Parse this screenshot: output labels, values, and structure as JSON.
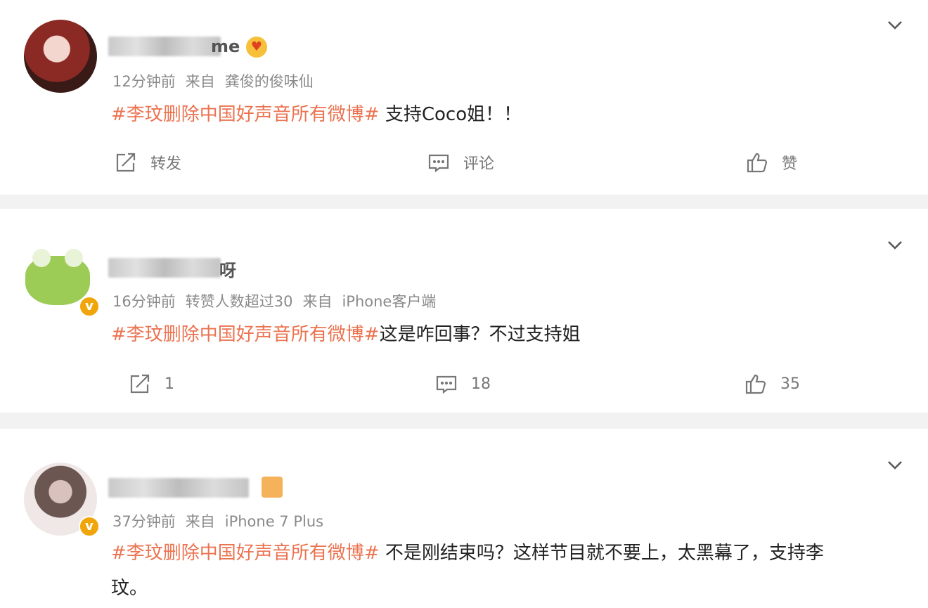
{
  "posts": [
    {
      "username_visible": "me",
      "time": "12分钟前",
      "source_prefix": "来自",
      "source": "龚俊的俊味仙",
      "hot_count": "",
      "topic": "#李玟删除中国好声音所有微博#",
      "text": " 支持Coco姐！！",
      "repost": "转发",
      "comment": "评论",
      "like": "赞"
    },
    {
      "username_visible": "呀",
      "time": "16分钟前",
      "hot_count": "转赞人数超过30",
      "source_prefix": "来自",
      "source": "iPhone客户端",
      "topic": "#李玟删除中国好声音所有微博#",
      "text": "这是咋回事？不过支持姐",
      "repost": "1",
      "comment": "18",
      "like": "35"
    },
    {
      "username_visible": "",
      "time": "37分钟前",
      "hot_count": "",
      "source_prefix": "来自",
      "source": "iPhone 7 Plus",
      "topic": "#李玟删除中国好声音所有微博#",
      "text": " 不是刚结束吗？这样节目就不要上，太黑幕了，支持李",
      "text_line2": "玟。"
    }
  ],
  "colors": {
    "topic": "#eb7350",
    "meta": "#8a8a8a",
    "background": "#f2f2f2",
    "verified": "#f0a50a"
  },
  "icons": [
    "repost-icon",
    "comment-icon",
    "like-icon",
    "chevron-down-icon",
    "verified-icon"
  ]
}
